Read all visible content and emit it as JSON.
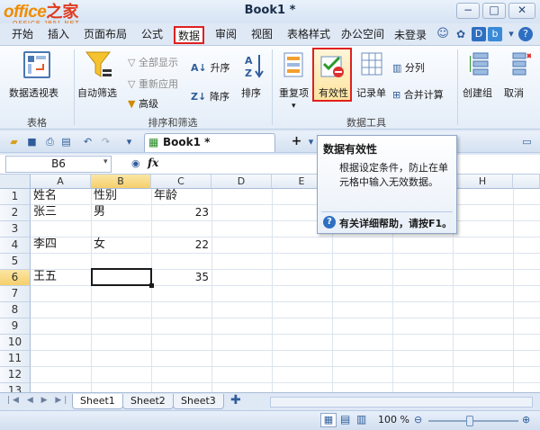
{
  "window": {
    "title": "Book1 *",
    "logo_main": "office",
    "logo_cn": "之家",
    "logo_sub": "OFFICE.JB51.NET",
    "buttons": [
      "−",
      "□",
      "✕"
    ]
  },
  "menu": {
    "tabs": [
      "开始",
      "插入",
      "页面布局",
      "公式",
      "数据",
      "审阅",
      "视图",
      "表格样式",
      "办公空间"
    ],
    "active_tab": "数据",
    "login": "未登录"
  },
  "ribbon": {
    "pivot_label": "数据透视表",
    "pivot_group": "表格",
    "autofilter_label": "自动筛选",
    "show_all_label": "全部显示",
    "reapply_label": "重新应用",
    "advanced_label": "高级",
    "sort_asc_label": "升序",
    "sort_desc_label": "降序",
    "sort_label": "排序",
    "sort_filter_group": "排序和筛选",
    "duplicates_label": "重复项",
    "validation_label": "有效性",
    "records_label": "记录单",
    "split_label": "分列",
    "merge_calc_label": "合并计算",
    "data_tools_group": "数据工具",
    "create_group_label": "创建组",
    "cancel_label": "取消"
  },
  "doc": {
    "tab_title": "Book1 *",
    "add_tab": "+"
  },
  "formula_bar": {
    "name_box": "B6",
    "fx": "fx",
    "content": ""
  },
  "tooltip": {
    "title": "数据有效性",
    "body": "根据设定条件，防止在单元格中输入无效数据。",
    "help": "有关详细帮助，请按F1。"
  },
  "sheet": {
    "columns": [
      "A",
      "B",
      "C",
      "D",
      "E",
      "F",
      "G",
      "H"
    ],
    "rows": [
      "1",
      "2",
      "3",
      "4",
      "5",
      "6",
      "7",
      "8",
      "9",
      "10",
      "11",
      "12",
      "13"
    ],
    "selected_cell": "B6",
    "cells": {
      "A1": "姓名",
      "B1": "性别",
      "C1": "年龄",
      "A2": "张三",
      "B2": "男",
      "C2": "23",
      "A4": "李四",
      "B4": "女",
      "C4": "22",
      "A6": "王五",
      "C6": "35"
    }
  },
  "sheet_tabs": [
    "Sheet1",
    "Sheet2",
    "Sheet3"
  ],
  "status": {
    "zoom": "100 %"
  }
}
